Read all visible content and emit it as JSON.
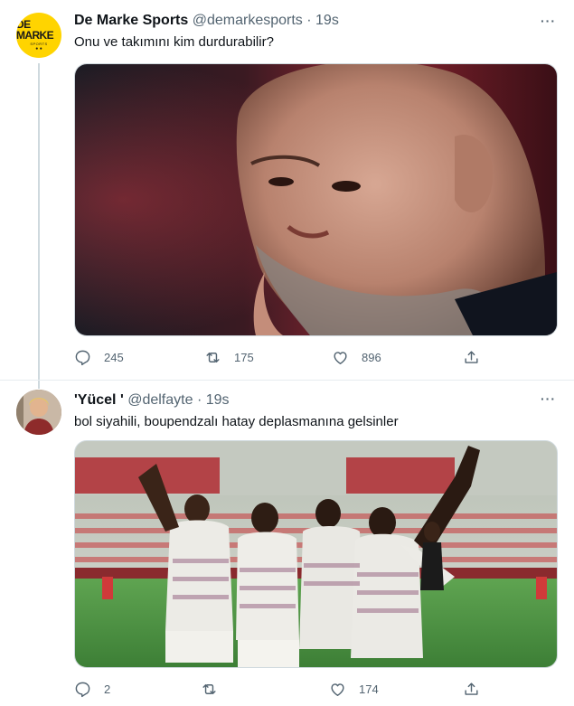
{
  "tweets": [
    {
      "author": "De Marke Sports",
      "handle": "@demarkesports",
      "separator": "·",
      "time": "19s",
      "text": "Onu ve takımını kim durdurabilir?",
      "avatar_logo": {
        "main": "DE MARKE",
        "sub": "SPORTS",
        "dots": "● ●"
      },
      "replies": "245",
      "retweets": "175",
      "likes": "896"
    },
    {
      "author": "'Yücel '",
      "handle": "@delfayte",
      "separator": "·",
      "time": "19s",
      "text": "bol siyahili, boupendzalı hatay deplasmanına gelsinler",
      "replies": "2",
      "retweets": "",
      "likes": "174"
    }
  ],
  "more_icon": "···",
  "colors": {
    "secondary_text": "#536471",
    "thread_line": "#cfd9de",
    "brand_yellow": "#ffd400"
  },
  "icons": [
    "reply-icon",
    "retweet-icon",
    "like-icon",
    "share-icon",
    "more-icon"
  ]
}
